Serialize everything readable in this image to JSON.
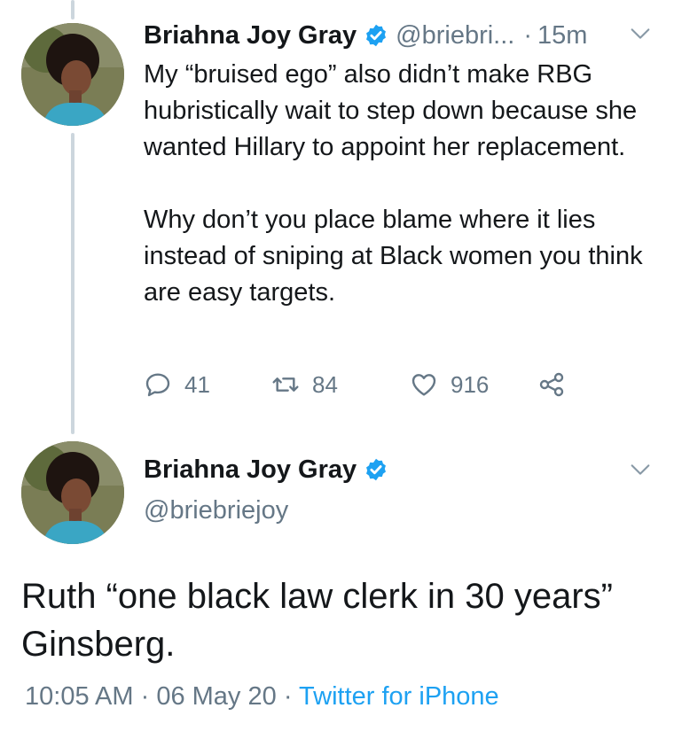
{
  "reply_tweet": {
    "author_name": "Briahna Joy Gray",
    "handle": "@briebri...",
    "separator": "·",
    "time": "15m",
    "paragraphs": [
      "My “bruised ego” also didn’t make RBG hubristically wait to step down because she wanted Hillary to appoint her replacement.",
      "Why don’t you place blame where it lies instead of sniping at Black women you think are easy targets."
    ],
    "actions": {
      "replies": "41",
      "retweets": "84",
      "likes": "916"
    }
  },
  "main_tweet": {
    "author_name": "Briahna Joy Gray",
    "handle": "@briebriejoy",
    "text": "Ruth “one black law clerk in 30 years” Ginsberg.",
    "time": "10:05 AM",
    "date": "06 May 20",
    "source": "Twitter for iPhone",
    "sep": "·"
  },
  "colors": {
    "verified": "#1da1f2",
    "muted": "#657786",
    "link": "#1da1f2",
    "thread_line": "#ccd6dd"
  },
  "icons": [
    "verified-badge-icon",
    "chevron-down-icon",
    "reply-icon",
    "retweet-icon",
    "like-icon",
    "share-icon"
  ]
}
